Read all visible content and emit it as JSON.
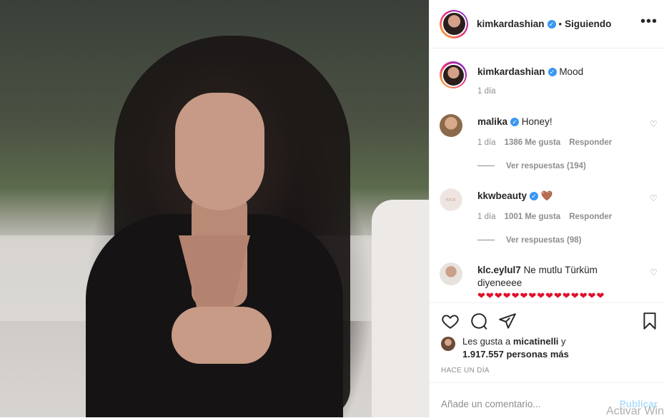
{
  "post": {
    "author": "kimkardashian",
    "follow_status": "Siguiendo",
    "separator": "•",
    "more_icon": "more-horizontal-icon",
    "caption": "Mood",
    "caption_age": "1 día"
  },
  "comments": [
    {
      "user": "malika",
      "verified": true,
      "text": "Honey!",
      "age": "1 día",
      "likes": "1386 Me gusta",
      "reply": "Responder",
      "view_replies": "Ver respuestas (194)"
    },
    {
      "user": "kkwbeauty",
      "verified": true,
      "text": "🤎",
      "age": "1 día",
      "likes": "1001 Me gusta",
      "reply": "Responder",
      "view_replies": "Ver respuestas (98)"
    },
    {
      "user": "klc.eylul7",
      "verified": false,
      "text": "Ne mutlu Türküm diyeneeee",
      "hearts": "❤❤❤❤❤❤❤❤❤❤❤❤❤❤❤"
    }
  ],
  "likes": {
    "prefix": "Les gusta a",
    "user": "micatinelli",
    "suffix": "y",
    "count": "1.917.557 personas más"
  },
  "timestamp": "HACE UN DÍA",
  "add_comment": {
    "placeholder": "Añade un comentario...",
    "publish": "Publicar"
  },
  "watermark": "Activar Win",
  "colors": {
    "verified": "#3897f0",
    "link_disabled": "#b2dffc",
    "muted": "#8e8e8e"
  }
}
